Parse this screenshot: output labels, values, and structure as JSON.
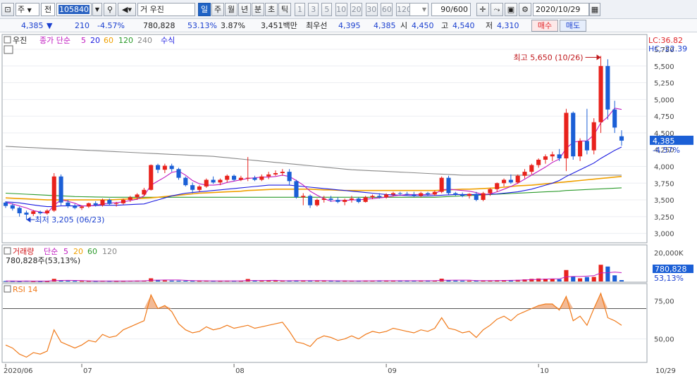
{
  "toolbar": {
    "type_label": "주",
    "prefix": "전",
    "code": "105840",
    "name_prefix": "거",
    "stock_name": "우진",
    "periods": [
      "일",
      "주",
      "월",
      "년",
      "분",
      "초",
      "틱"
    ],
    "active_period": "일",
    "intervals": [
      "1",
      "3",
      "5",
      "10",
      "20",
      "30",
      "60",
      "120"
    ],
    "count": "90/600",
    "date": "2020/10/29"
  },
  "quote": {
    "price": "4,385",
    "change_arrow": "▼",
    "change": "210",
    "change_pct": "-4.57%",
    "volume": "780,828",
    "volume_ratio": "53.13%",
    "turnover": "3.87%",
    "amount": "3,451백만",
    "best_label": "최우선",
    "best_ask": "4,395",
    "best_bid": "4,385",
    "open_label": "시",
    "open": "4,450",
    "high_label": "고",
    "high": "4,540",
    "low_label": "저",
    "low": "4,310",
    "buy_label": "매수",
    "sell_label": "매도"
  },
  "price_panel": {
    "legend": {
      "name": "우진",
      "ma_title": "종가 단순",
      "ma_periods": [
        "5",
        "20",
        "60",
        "120",
        "240"
      ],
      "formula": "수식"
    },
    "lc": "LC:36.82",
    "hc": "HC:-22.39",
    "current_price": "4,385",
    "current_pct": "-4.57%",
    "high_annotation": "최고 5,650 (10/26)",
    "low_annotation": "최저 3,205 (06/23)",
    "yticks": [
      "5,750",
      "5,500",
      "5,250",
      "5,000",
      "4,750",
      "4,500",
      "4,250",
      "4,000",
      "3,750",
      "3,500",
      "3,250",
      "3,000"
    ]
  },
  "volume_panel": {
    "title": "거래량",
    "ma_title": "단순",
    "ma_periods": [
      "5",
      "20",
      "60",
      "120"
    ],
    "info": "780,828주(53,13%)",
    "ytick": "20,000K",
    "current_volume": "780,828",
    "current_pct": "53,13%"
  },
  "rsi_panel": {
    "title": "RSI 14",
    "yticks": [
      "75,00",
      "50,00"
    ],
    "upper_line": 70,
    "lower_line": 30
  },
  "x_axis": {
    "labels": [
      "2020/06",
      "07",
      "08",
      "09",
      "10"
    ],
    "right_label": "10/29"
  },
  "colors": {
    "up": "#e8221c",
    "down": "#1b5fd6",
    "ma5": "#c01ac0",
    "ma20": "#1a1ae0",
    "ma60": "#f0a000",
    "ma120": "#2a9a2a",
    "ma240": "#888888",
    "rsi": "#f07a1a"
  },
  "chart_data": {
    "type": "candlestick",
    "ohlc": [
      [
        3460,
        3480,
        3380,
        3410
      ],
      [
        3420,
        3450,
        3340,
        3370
      ],
      [
        3380,
        3400,
        3250,
        3300
      ],
      [
        3310,
        3340,
        3205,
        3280
      ],
      [
        3290,
        3350,
        3260,
        3330
      ],
      [
        3320,
        3340,
        3280,
        3300
      ],
      [
        3300,
        3360,
        3280,
        3340
      ],
      [
        3340,
        3900,
        3320,
        3850
      ],
      [
        3850,
        3880,
        3420,
        3460
      ],
      [
        3460,
        3500,
        3380,
        3410
      ],
      [
        3410,
        3440,
        3360,
        3380
      ],
      [
        3380,
        3420,
        3350,
        3400
      ],
      [
        3400,
        3460,
        3380,
        3450
      ],
      [
        3450,
        3480,
        3400,
        3420
      ],
      [
        3420,
        3520,
        3400,
        3500
      ],
      [
        3500,
        3520,
        3420,
        3440
      ],
      [
        3440,
        3470,
        3400,
        3450
      ],
      [
        3450,
        3520,
        3430,
        3500
      ],
      [
        3500,
        3560,
        3470,
        3540
      ],
      [
        3540,
        3600,
        3500,
        3580
      ],
      [
        3580,
        3680,
        3560,
        3650
      ],
      [
        3650,
        4030,
        3640,
        4020
      ],
      [
        4020,
        4040,
        3900,
        3950
      ],
      [
        3950,
        4040,
        3900,
        4010
      ],
      [
        4010,
        4040,
        3920,
        3960
      ],
      [
        3960,
        3980,
        3800,
        3830
      ],
      [
        3830,
        3850,
        3700,
        3720
      ],
      [
        3720,
        3760,
        3600,
        3650
      ],
      [
        3650,
        3720,
        3620,
        3700
      ],
      [
        3700,
        3820,
        3680,
        3800
      ],
      [
        3800,
        3850,
        3740,
        3760
      ],
      [
        3760,
        3820,
        3720,
        3800
      ],
      [
        3800,
        3880,
        3760,
        3860
      ],
      [
        3860,
        3880,
        3780,
        3800
      ],
      [
        3800,
        3860,
        3780,
        3830
      ],
      [
        3830,
        4140,
        3780,
        3830
      ],
      [
        3830,
        3860,
        3780,
        3800
      ],
      [
        3800,
        3880,
        3780,
        3850
      ],
      [
        3850,
        3920,
        3810,
        3880
      ],
      [
        3880,
        3940,
        3860,
        3900
      ],
      [
        3900,
        3960,
        3860,
        3920
      ],
      [
        3920,
        3960,
        3720,
        3780
      ],
      [
        3780,
        3800,
        3520,
        3540
      ],
      [
        3540,
        3600,
        3420,
        3560
      ],
      [
        3560,
        3580,
        3380,
        3420
      ],
      [
        3420,
        3520,
        3400,
        3500
      ],
      [
        3500,
        3560,
        3460,
        3520
      ],
      [
        3520,
        3560,
        3470,
        3500
      ],
      [
        3500,
        3540,
        3450,
        3470
      ],
      [
        3470,
        3520,
        3420,
        3500
      ],
      [
        3500,
        3560,
        3460,
        3520
      ],
      [
        3520,
        3540,
        3450,
        3470
      ],
      [
        3470,
        3560,
        3460,
        3540
      ],
      [
        3540,
        3580,
        3510,
        3560
      ],
      [
        3560,
        3600,
        3520,
        3540
      ],
      [
        3540,
        3600,
        3520,
        3580
      ],
      [
        3580,
        3620,
        3550,
        3600
      ],
      [
        3600,
        3620,
        3560,
        3590
      ],
      [
        3590,
        3620,
        3560,
        3580
      ],
      [
        3580,
        3620,
        3540,
        3560
      ],
      [
        3560,
        3620,
        3540,
        3600
      ],
      [
        3600,
        3620,
        3560,
        3580
      ],
      [
        3580,
        3640,
        3560,
        3620
      ],
      [
        3620,
        3850,
        3600,
        3830
      ],
      [
        3830,
        3860,
        3580,
        3600
      ],
      [
        3600,
        3620,
        3560,
        3580
      ],
      [
        3580,
        3610,
        3540,
        3560
      ],
      [
        3560,
        3600,
        3520,
        3590
      ],
      [
        3590,
        3620,
        3480,
        3500
      ],
      [
        3500,
        3620,
        3480,
        3600
      ],
      [
        3600,
        3680,
        3560,
        3660
      ],
      [
        3660,
        3760,
        3620,
        3750
      ],
      [
        3750,
        3820,
        3700,
        3800
      ],
      [
        3800,
        3880,
        3740,
        3760
      ],
      [
        3760,
        3880,
        3740,
        3860
      ],
      [
        3860,
        3960,
        3820,
        3920
      ],
      [
        3920,
        4040,
        3880,
        4020
      ],
      [
        4020,
        4120,
        3980,
        4100
      ],
      [
        4100,
        4180,
        4040,
        4150
      ],
      [
        4150,
        4220,
        4080,
        4180
      ],
      [
        4180,
        4260,
        4080,
        4120
      ],
      [
        4120,
        4860,
        3930,
        4800
      ],
      [
        4800,
        4820,
        4100,
        4150
      ],
      [
        4150,
        4420,
        4080,
        4380
      ],
      [
        4380,
        4860,
        4180,
        4240
      ],
      [
        4240,
        4720,
        4180,
        4660
      ],
      [
        4660,
        5650,
        4500,
        5500
      ],
      [
        5500,
        5600,
        4700,
        4850
      ],
      [
        4850,
        4980,
        4500,
        4580
      ],
      [
        4450,
        4540,
        4310,
        4385
      ]
    ],
    "volume_k": [
      300,
      250,
      200,
      350,
      220,
      200,
      180,
      1500,
      600,
      400,
      300,
      250,
      300,
      280,
      350,
      300,
      280,
      320,
      400,
      420,
      500,
      1800,
      900,
      600,
      500,
      450,
      400,
      350,
      330,
      400,
      350,
      330,
      380,
      350,
      330,
      1400,
      400,
      380,
      420,
      450,
      430,
      500,
      600,
      550,
      480,
      420,
      400,
      380,
      350,
      380,
      400,
      380,
      420,
      450,
      430,
      420,
      450,
      430,
      420,
      410,
      430,
      420,
      450,
      1600,
      700,
      500,
      450,
      430,
      480,
      460,
      520,
      700,
      800,
      700,
      900,
      1200,
      1500,
      1700,
      1600,
      1400,
      1300,
      6500,
      3000,
      1800,
      2500,
      2600,
      9500,
      8500,
      3500,
      781
    ],
    "ma": {
      "ma5": [
        3460,
        3440,
        3410,
        3380,
        3340,
        3320,
        3300,
        3420,
        3500,
        3480,
        3450,
        3410,
        3410,
        3420,
        3440,
        3450,
        3460,
        3470,
        3490,
        3510,
        3560,
        3720,
        3780,
        3840,
        3910,
        3930,
        3870,
        3790,
        3740,
        3720,
        3720,
        3730,
        3760,
        3780,
        3800,
        3820,
        3830,
        3840,
        3840,
        3850,
        3870,
        3850,
        3790,
        3720,
        3630,
        3570,
        3520,
        3480,
        3490,
        3490,
        3500,
        3500,
        3510,
        3520,
        3530,
        3540,
        3560,
        3570,
        3580,
        3580,
        3580,
        3580,
        3590,
        3650,
        3660,
        3650,
        3640,
        3630,
        3610,
        3580,
        3590,
        3620,
        3660,
        3700,
        3750,
        3810,
        3870,
        3930,
        3990,
        4060,
        4110,
        4270,
        4360,
        4380,
        4380,
        4470,
        4650,
        4740,
        4870,
        4850
      ],
      "ma20": [
        3470,
        3465,
        3455,
        3440,
        3425,
        3410,
        3400,
        3400,
        3410,
        3410,
        3410,
        3410,
        3410,
        3415,
        3420,
        3420,
        3420,
        3425,
        3430,
        3435,
        3440,
        3470,
        3500,
        3530,
        3560,
        3580,
        3600,
        3610,
        3620,
        3630,
        3640,
        3650,
        3660,
        3670,
        3680,
        3690,
        3700,
        3710,
        3720,
        3720,
        3720,
        3720,
        3710,
        3700,
        3690,
        3680,
        3670,
        3660,
        3650,
        3640,
        3630,
        3620,
        3610,
        3600,
        3590,
        3580,
        3575,
        3570,
        3565,
        3560,
        3560,
        3560,
        3565,
        3570,
        3575,
        3580,
        3580,
        3580,
        3580,
        3580,
        3585,
        3590,
        3600,
        3610,
        3620,
        3640,
        3660,
        3690,
        3720,
        3750,
        3790,
        3850,
        3900,
        3950,
        4000,
        4050,
        4120,
        4180,
        4240,
        4290
      ],
      "ma60": [
        3530,
        3525,
        3520,
        3515,
        3510,
        3505,
        3500,
        3500,
        3500,
        3500,
        3500,
        3500,
        3500,
        3500,
        3500,
        3500,
        3505,
        3510,
        3515,
        3520,
        3525,
        3530,
        3540,
        3550,
        3560,
        3570,
        3580,
        3590,
        3600,
        3605,
        3610,
        3615,
        3620,
        3625,
        3630,
        3640,
        3645,
        3650,
        3655,
        3660,
        3660,
        3660,
        3660,
        3660,
        3660,
        3655,
        3650,
        3650,
        3645,
        3640,
        3640,
        3640,
        3640,
        3640,
        3640,
        3640,
        3640,
        3640,
        3640,
        3640,
        3640,
        3640,
        3640,
        3645,
        3650,
        3655,
        3660,
        3660,
        3665,
        3670,
        3675,
        3680,
        3690,
        3700,
        3710,
        3715,
        3720,
        3730,
        3740,
        3750,
        3760,
        3770,
        3780,
        3790,
        3800,
        3810,
        3820,
        3830,
        3840,
        3850
      ],
      "ma120": [
        3600,
        3595,
        3590,
        3585,
        3580,
        3575,
        3570,
        3565,
        3560,
        3555,
        3550,
        3548,
        3546,
        3544,
        3542,
        3540,
        3540,
        3540,
        3540,
        3540,
        3540,
        3540,
        3540,
        3540,
        3540,
        3540,
        3540,
        3540,
        3540,
        3540,
        3540,
        3540,
        3540,
        3540,
        3540,
        3540,
        3540,
        3540,
        3540,
        3540,
        3540,
        3540,
        3540,
        3540,
        3540,
        3540,
        3540,
        3540,
        3540,
        3540,
        3540,
        3540,
        3540,
        3540,
        3540,
        3540,
        3540,
        3540,
        3540,
        3540,
        3540,
        3540,
        3540,
        3545,
        3550,
        3555,
        3560,
        3565,
        3570,
        3575,
        3580,
        3585,
        3590,
        3595,
        3600,
        3605,
        3610,
        3615,
        3620,
        3625,
        3630,
        3640,
        3645,
        3650,
        3655,
        3660,
        3665,
        3670,
        3675,
        3680
      ],
      "ma240": [
        4300,
        4295,
        4290,
        4285,
        4280,
        4275,
        4270,
        4265,
        4260,
        4255,
        4250,
        4245,
        4240,
        4235,
        4230,
        4225,
        4220,
        4215,
        4210,
        4205,
        4200,
        4195,
        4190,
        4185,
        4180,
        4175,
        4170,
        4165,
        4160,
        4155,
        4150,
        4140,
        4130,
        4120,
        4110,
        4100,
        4090,
        4080,
        4070,
        4060,
        4050,
        4040,
        4030,
        4020,
        4010,
        4000,
        3990,
        3980,
        3970,
        3960,
        3950,
        3945,
        3940,
        3935,
        3930,
        3925,
        3920,
        3915,
        3910,
        3905,
        3900,
        3895,
        3890,
        3885,
        3880,
        3875,
        3870,
        3870,
        3870,
        3870,
        3870,
        3870,
        3870,
        3870,
        3870,
        3870,
        3870,
        3870,
        3870,
        3870,
        3870,
        3870,
        3870,
        3870,
        3870,
        3870,
        3870,
        3870,
        3870,
        3870
      ]
    },
    "volume_ma5_k": [
      300,
      280,
      260,
      270,
      260,
      240,
      230,
      500,
      600,
      620,
      600,
      580,
      370,
      320,
      300,
      300,
      300,
      310,
      330,
      350,
      370,
      690,
      770,
      830,
      860,
      850,
      640,
      520,
      460,
      410,
      380,
      360,
      360,
      350,
      350,
      560,
      560,
      570,
      590,
      620,
      420,
      440,
      470,
      500,
      520,
      520,
      490,
      450,
      410,
      390,
      380,
      380,
      390,
      400,
      420,
      420,
      430,
      440,
      440,
      430,
      430,
      430,
      430,
      670,
      720,
      740,
      740,
      750,
      530,
      480,
      480,
      530,
      610,
      650,
      730,
      850,
      1020,
      1180,
      1360,
      1480,
      1500,
      2660,
      2860,
      2860,
      3040,
      3280,
      4880,
      4980,
      5340,
      5000
    ],
    "rsi": [
      46,
      44,
      40,
      38,
      41,
      40,
      42,
      56,
      48,
      46,
      44,
      46,
      49,
      48,
      53,
      51,
      52,
      56,
      58,
      60,
      62,
      79,
      70,
      72,
      68,
      60,
      56,
      54,
      55,
      58,
      56,
      57,
      59,
      57,
      58,
      59,
      57,
      58,
      59,
      60,
      61,
      55,
      48,
      47,
      45,
      50,
      52,
      51,
      49,
      50,
      52,
      50,
      53,
      55,
      54,
      55,
      57,
      56,
      55,
      54,
      56,
      55,
      57,
      64,
      57,
      56,
      54,
      55,
      51,
      56,
      59,
      63,
      65,
      62,
      66,
      68,
      70,
      72,
      73,
      73,
      69,
      78,
      62,
      65,
      59,
      70,
      80,
      64,
      62,
      59
    ],
    "ylim": [
      2870,
      5960
    ],
    "volume_ylim": [
      0,
      20000
    ],
    "rsi_ylim": [
      35,
      86
    ]
  }
}
